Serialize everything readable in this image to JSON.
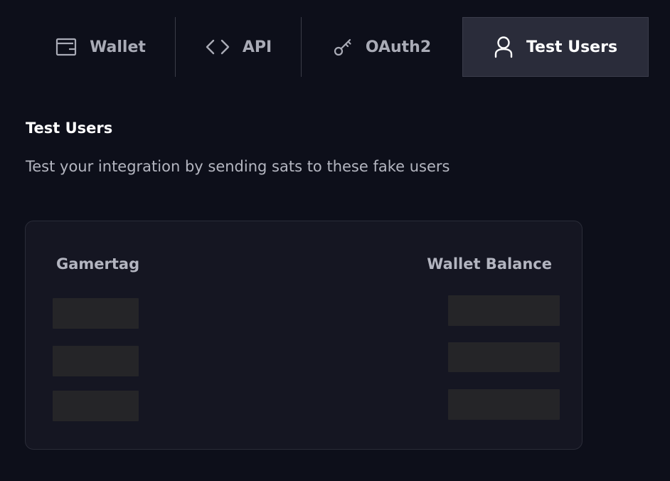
{
  "tabs": [
    {
      "label": "Wallet",
      "icon": "wallet-icon"
    },
    {
      "label": "API",
      "icon": "code-icon"
    },
    {
      "label": "OAuth2",
      "icon": "key-icon"
    },
    {
      "label": "Test Users",
      "icon": "user-icon",
      "selected": true
    }
  ],
  "section": {
    "title": "Test Users",
    "description": "Test your integration by sending sats to these fake users"
  },
  "table": {
    "columns": [
      "Gamertag",
      "Wallet Balance"
    ],
    "rows_loading": 3
  },
  "colors": {
    "background": "#0d0f1a",
    "selected_tab": "#2a2c3a",
    "card": "#151622",
    "skeleton": "#252528"
  }
}
